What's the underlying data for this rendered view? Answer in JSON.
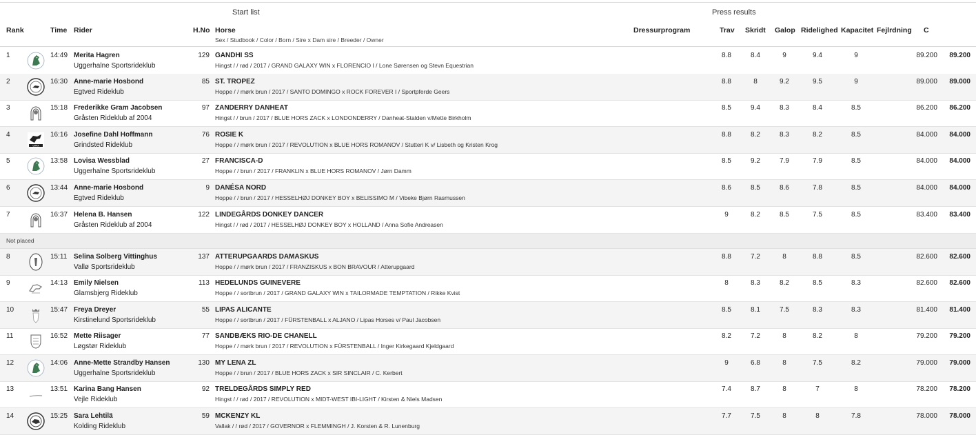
{
  "sections": {
    "start_list": "Start list",
    "press_results": "Press results"
  },
  "headers": {
    "rank": "Rank",
    "time": "Time",
    "rider": "Rider",
    "hno": "H.No",
    "horse": "Horse",
    "horse_sub": "Sex / Studbook / Color / Born / Sire x Dam sire / Breeder / Owner",
    "dressurprogram": "Dressurprogram",
    "trav": "Trav",
    "skridt": "Skridt",
    "galop": "Galop",
    "ridelighed": "Ridelighed",
    "kapacitet": "Kapacitet",
    "fejlrdning": "Fejlrdning",
    "c": "C"
  },
  "not_placed": "Not placed",
  "rows": [
    {
      "rank": "1",
      "time": "14:49",
      "rider": "Merita Hagren",
      "club": "Uggerhalne Sportsrideklub",
      "hno": "129",
      "horse": "GANDHI SS",
      "horse_info": "Hingst / / rød / 2017 / GRAND GALAXY WIN x FLORENCIO I / Lone Sørensen og Stevn Equestrian",
      "trav": "8.8",
      "skridt": "8.4",
      "galop": "9",
      "ridelighed": "9.4",
      "kapacitet": "9",
      "c1": "89.200",
      "c2": "89.200",
      "logo": "horse-head-logo"
    },
    {
      "rank": "2",
      "time": "16:30",
      "rider": "Anne-marie Hosbond",
      "club": "Egtved Rideklub",
      "hno": "85",
      "horse": "ST. TROPEZ",
      "horse_info": "Hoppe / / mørk brun / 2017 / SANTO DOMINGO x ROCK FOREVER I / Sportpferde Geers",
      "trav": "8.8",
      "skridt": "8",
      "galop": "9.2",
      "ridelighed": "9.5",
      "kapacitet": "9",
      "c1": "89.000",
      "c2": "89.000",
      "logo": "round-emblem-logo"
    },
    {
      "rank": "3",
      "time": "15:18",
      "rider": "Frederikke Gram Jacobsen",
      "club": "Gråsten Rideklub af 2004",
      "hno": "97",
      "horse": "ZANDERRY DANHEAT",
      "horse_info": "Hingst / / brun / 2017 / BLUE HORS ZACK x LONDONDERRY / Danheat-Stalden v/Mette Birkholm",
      "trav": "8.5",
      "skridt": "9.4",
      "galop": "8.3",
      "ridelighed": "8.4",
      "kapacitet": "8.5",
      "c1": "86.200",
      "c2": "86.200",
      "logo": "horseshoe-logo"
    },
    {
      "rank": "4",
      "time": "16:16",
      "rider": "Josefine Dahl Hoffmann",
      "club": "Grindsted Rideklub",
      "hno": "76",
      "horse": "ROSIE K",
      "horse_info": "Hoppe / / mørk brun / 2017 / REVOLUTION x BLUE HORS ROMANOV / Stutteri K v/ Lisbeth og Kristen Krog",
      "trav": "8.8",
      "skridt": "8.2",
      "galop": "8.3",
      "ridelighed": "8.2",
      "kapacitet": "8.5",
      "c1": "84.000",
      "c2": "84.000",
      "logo": "jumping-horse-logo"
    },
    {
      "rank": "5",
      "time": "13:58",
      "rider": "Lovisa Wessblad",
      "club": "Uggerhalne Sportsrideklub",
      "hno": "27",
      "horse": "FRANCISCA-D",
      "horse_info": "Hoppe / / brun / 2017 / FRANKLIN x BLUE HORS ROMANOV / Jørn Damm",
      "trav": "8.5",
      "skridt": "9.2",
      "galop": "7.9",
      "ridelighed": "7.9",
      "kapacitet": "8.5",
      "c1": "84.000",
      "c2": "84.000",
      "logo": "horse-head-logo"
    },
    {
      "rank": "6",
      "time": "13:44",
      "rider": "Anne-marie Hosbond",
      "club": "Egtved Rideklub",
      "hno": "9",
      "horse": "DANÉSA NORD",
      "horse_info": "Hoppe / / brun / 2017 / HESSELHØJ DONKEY BOY x BELISSIMO M / Vibeke Bjørn Rasmussen",
      "trav": "8.6",
      "skridt": "8.5",
      "galop": "8.6",
      "ridelighed": "7.8",
      "kapacitet": "8.5",
      "c1": "84.000",
      "c2": "84.000",
      "logo": "round-emblem-logo"
    },
    {
      "rank": "7",
      "time": "16:37",
      "rider": "Helena B. Hansen",
      "club": "Gråsten Rideklub af 2004",
      "hno": "122",
      "horse": "LINDEGÅRDS DONKEY DANCER",
      "horse_info": "Hingst / / rød / 2017 / HESSELHØJ DONKEY BOY x HOLLAND / Anna Sofie Andreasen",
      "trav": "9",
      "skridt": "8.2",
      "galop": "8.5",
      "ridelighed": "7.5",
      "kapacitet": "8.5",
      "c1": "83.400",
      "c2": "83.400",
      "logo": "horseshoe-logo"
    },
    {
      "rank": "8",
      "time": "15:11",
      "rider": "Selina Solberg Vittinghus",
      "club": "Vallø Sportsrideklub",
      "hno": "137",
      "horse": "ATTERUPGAARDS DAMASKUS",
      "horse_info": "Hoppe / / mørk brun / 2017 / FRANZISKUS x BON BRAVOUR / Atterupgaard",
      "trav": "8.8",
      "skridt": "7.2",
      "galop": "8",
      "ridelighed": "8.8",
      "kapacitet": "8.5",
      "c1": "82.600",
      "c2": "82.600",
      "logo": "oval-crest-logo"
    },
    {
      "rank": "9",
      "time": "14:13",
      "rider": "Emily Nielsen",
      "club": "Glamsbjerg Rideklub",
      "hno": "113",
      "horse": "HEDELUNDS GUINEVERE",
      "horse_info": "Hoppe / / sortbrun / 2017 / GRAND GALAXY WIN x TAILORMADE TEMPTATION / Rikke Kvist",
      "trav": "8",
      "skridt": "8.3",
      "galop": "8.2",
      "ridelighed": "8.5",
      "kapacitet": "8.3",
      "c1": "82.600",
      "c2": "82.600",
      "logo": "horse-sketch-logo"
    },
    {
      "rank": "10",
      "time": "15:47",
      "rider": "Freya Dreyer",
      "club": "Kirstinelund Sportsrideklub",
      "hno": "55",
      "horse": "LIPAS ALICANTE",
      "horse_info": "Hoppe / / sortbrun / 2017 / FÜRSTENBALL x ALJANO / Lipas Horses v/ Paul Jacobsen",
      "trav": "8.5",
      "skridt": "8.1",
      "galop": "7.5",
      "ridelighed": "8.3",
      "kapacitet": "8.3",
      "c1": "81.400",
      "c2": "81.400",
      "logo": "crown-crest-logo"
    },
    {
      "rank": "11",
      "time": "16:52",
      "rider": "Mette Riisager",
      "club": "Løgstør Rideklub",
      "hno": "77",
      "horse": "SANDBÆKS RIO-DE CHANELL",
      "horse_info": "Hoppe / / mørk brun / 2017 / REVOLUTION x FÜRSTENBALL / Inger Kirkegaard Kjeldgaard",
      "trav": "8.2",
      "skridt": "7.2",
      "galop": "8",
      "ridelighed": "8.2",
      "kapacitet": "8",
      "c1": "79.200",
      "c2": "79.200",
      "logo": "shield-crest-logo"
    },
    {
      "rank": "12",
      "time": "14:06",
      "rider": "Anne-Mette Strandby Hansen",
      "club": "Uggerhalne Sportsrideklub",
      "hno": "130",
      "horse": "MY LENA ZL",
      "horse_info": "Hoppe / / brun / 2017 / BLUE HORS ZACK x SIR SINCLAIR / C. Kerbert",
      "trav": "9",
      "skridt": "6.8",
      "galop": "8",
      "ridelighed": "7.5",
      "kapacitet": "8.2",
      "c1": "79.000",
      "c2": "79.000",
      "logo": "horse-head-logo"
    },
    {
      "rank": "13",
      "time": "13:51",
      "rider": "Karina Bang Hansen",
      "club": "Vejle Rideklub",
      "hno": "92",
      "horse": "TRELDEGÅRDS SIMPLY RED",
      "horse_info": "Hingst / / rød / 2017 / REVOLUTION x MIDT-WEST IBI-LIGHT / Kirsten & Niels Madsen",
      "trav": "7.4",
      "skridt": "8.7",
      "galop": "8",
      "ridelighed": "7",
      "kapacitet": "8",
      "c1": "78.200",
      "c2": "78.200",
      "logo": "line-mark-logo"
    },
    {
      "rank": "14",
      "time": "15:25",
      "rider": "Sara Lehtilä",
      "club": "Kolding Rideklub",
      "hno": "59",
      "horse": "MCKENZY KL",
      "horse_info": "Vallak / / rød / 2017 / GOVERNOR x FLEMMINGH / J. Korsten & R. Lunenburg",
      "trav": "7.7",
      "skridt": "7.5",
      "galop": "8",
      "ridelighed": "8",
      "kapacitet": "7.8",
      "c1": "78.000",
      "c2": "78.000",
      "logo": "round-seal-logo"
    }
  ]
}
